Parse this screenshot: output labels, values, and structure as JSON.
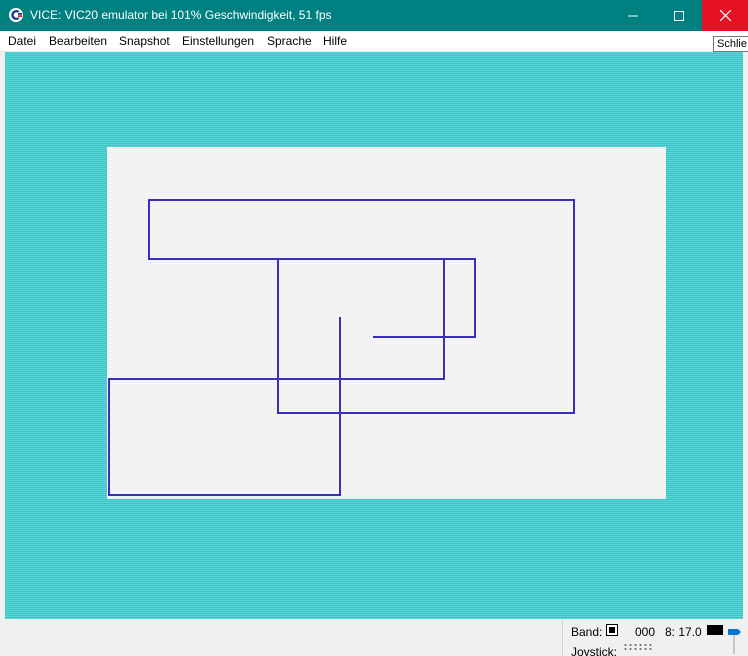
{
  "window": {
    "title": "VICE: VIC20 emulator bei 101% Geschwindigkeit, 51 fps",
    "close_tooltip": "Schlie",
    "colors": {
      "titlebar": "#008080",
      "close_hover": "#e81123",
      "screen_border": "#4fcfd2",
      "screen_paper": "#f4f4f4",
      "plot_line": "#3a2fb8"
    }
  },
  "menu": {
    "items": [
      {
        "label": "Datei"
      },
      {
        "label": "Bearbeiten"
      },
      {
        "label": "Snapshot"
      },
      {
        "label": "Einstellungen"
      },
      {
        "label": "Sprache"
      },
      {
        "label": "Hilfe"
      }
    ]
  },
  "status": {
    "tape_label": "Band:",
    "tape_counter": "000",
    "drive_label": "8: 17.0",
    "joystick_label": "Joystick:"
  },
  "icons": {
    "app": "commodore-logo-icon",
    "minimize": "minimize-icon",
    "maximize": "maximize-icon",
    "close": "close-icon",
    "tape": "tape-icon",
    "drive_led": "drive-led-icon",
    "volume": "volume-slider-icon"
  }
}
